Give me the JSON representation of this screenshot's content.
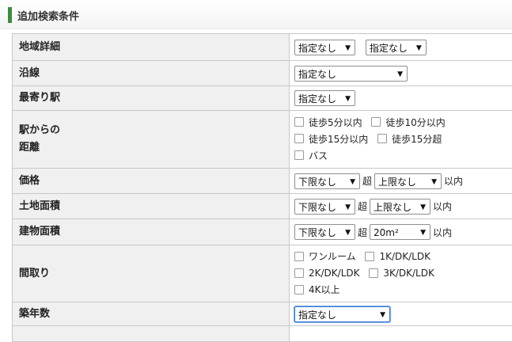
{
  "header": {
    "title": "追加検索条件",
    "accent_color": "#3d8b3d"
  },
  "rows": {
    "area": {
      "label": "地域詳細",
      "select1": "指定なし",
      "select2": "指定なし"
    },
    "line": {
      "label": "沿線",
      "select": "指定なし"
    },
    "station": {
      "label": "最寄り駅",
      "select": "指定なし"
    },
    "distance": {
      "label_line1": "駅からの",
      "label_line2": "距離",
      "options": [
        "徒歩5分以内",
        "徒歩10分以内",
        "徒歩15分以内",
        "徒歩15分超",
        "バス"
      ]
    },
    "price": {
      "label": "価格",
      "min": "下限なし",
      "over": "超",
      "max": "上限なし",
      "within": "以内"
    },
    "land": {
      "label": "土地面積",
      "min": "下限なし",
      "over": "超",
      "max": "上限なし",
      "within": "以内"
    },
    "building": {
      "label": "建物面積",
      "min": "下限なし",
      "over": "超",
      "max": "20m²",
      "within": "以内"
    },
    "layout": {
      "label": "間取り",
      "options": [
        "ワンルーム",
        "1K/DK/LDK",
        "2K/DK/LDK",
        "3K/DK/LDK",
        "4K以上"
      ]
    },
    "age": {
      "label": "築年数",
      "select": "指定なし"
    }
  }
}
